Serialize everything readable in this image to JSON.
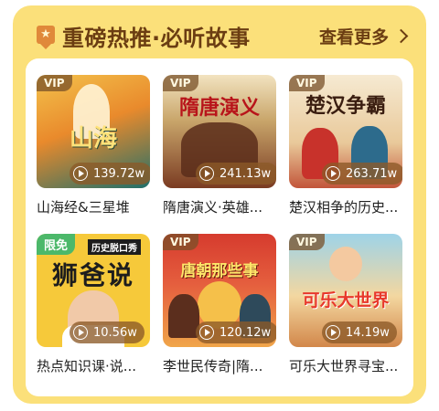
{
  "section": {
    "title": "重磅热推·必听故事",
    "more_label": "查看更多"
  },
  "cards": [
    {
      "badge": "VIP",
      "art_text": "山海",
      "plays": "139.72w",
      "title": "山海经&三星堆"
    },
    {
      "badge": "VIP",
      "art_text": "隋唐演义",
      "plays": "241.13w",
      "title": "隋唐演义·英雄..."
    },
    {
      "badge": "VIP",
      "art_text": "楚汉争霸",
      "plays": "263.71w",
      "title": "楚汉相争的历史..."
    },
    {
      "badge": "限免",
      "art_text": "狮爸说",
      "art_subtext": "历史脱口秀",
      "plays": "10.56w",
      "title": "热点知识课·说..."
    },
    {
      "badge": "VIP",
      "art_text": "唐朝那些事",
      "plays": "120.12w",
      "title": "李世民传奇|隋..."
    },
    {
      "badge": "VIP",
      "art_text": "可乐大世界",
      "plays": "14.19w",
      "title": "可乐大世界寻宝..."
    }
  ]
}
